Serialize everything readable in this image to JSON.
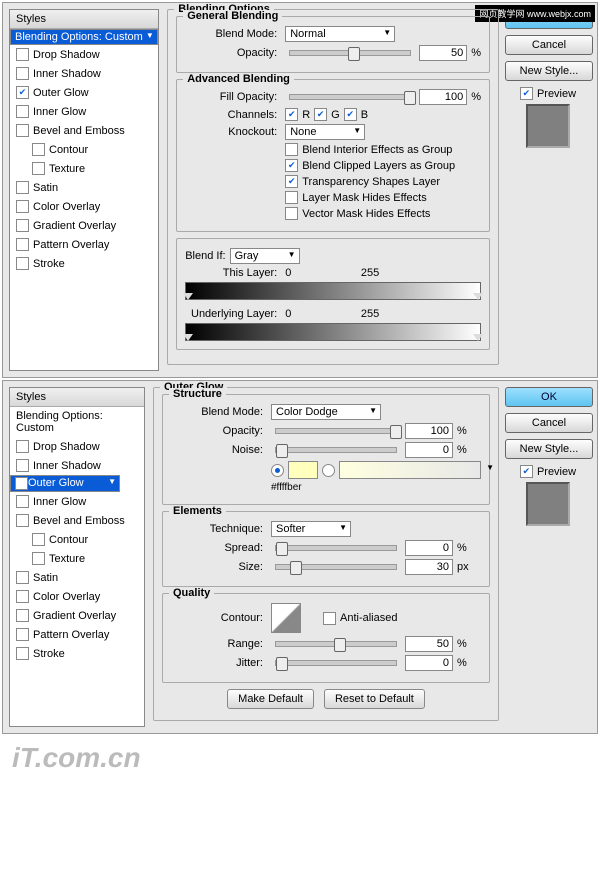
{
  "watermark": "网页教学网 www.webjx.com",
  "stylesHeader": "Styles",
  "styleItems": {
    "blendOpt": "Blending Options: Custom",
    "dropShadow": "Drop Shadow",
    "innerShadow": "Inner Shadow",
    "outerGlow": "Outer Glow",
    "innerGlow": "Inner Glow",
    "bevel": "Bevel and Emboss",
    "contour": "Contour",
    "texture": "Texture",
    "satin": "Satin",
    "colorOverlay": "Color Overlay",
    "gradOverlay": "Gradient Overlay",
    "patternOverlay": "Pattern Overlay",
    "stroke": "Stroke"
  },
  "buttons": {
    "ok": "OK",
    "cancel": "Cancel",
    "newStyle": "New Style...",
    "preview": "Preview",
    "makeDefault": "Make Default",
    "resetDefault": "Reset to Default"
  },
  "dialog1": {
    "title": "Blending Options",
    "general": {
      "title": "General Blending",
      "blendModeLabel": "Blend Mode:",
      "blendMode": "Normal",
      "opacityLabel": "Opacity:",
      "opacity": "50",
      "pct": "%"
    },
    "advanced": {
      "title": "Advanced Blending",
      "fillOpacityLabel": "Fill Opacity:",
      "fillOpacity": "100",
      "channelsLabel": "Channels:",
      "r": "R",
      "g": "G",
      "b": "B",
      "knockoutLabel": "Knockout:",
      "knockout": "None",
      "opt1": "Blend Interior Effects as Group",
      "opt2": "Blend Clipped Layers as Group",
      "opt3": "Transparency Shapes Layer",
      "opt4": "Layer Mask Hides Effects",
      "opt5": "Vector Mask Hides Effects"
    },
    "blendIf": {
      "label": "Blend If:",
      "mode": "Gray",
      "thisLayer": "This Layer:",
      "underLayer": "Underlying Layer:",
      "v0": "0",
      "v255": "255"
    }
  },
  "dialog2": {
    "title": "Outer Glow",
    "structure": {
      "title": "Structure",
      "blendModeLabel": "Blend Mode:",
      "blendMode": "Color Dodge",
      "opacityLabel": "Opacity:",
      "opacity": "100",
      "noiseLabel": "Noise:",
      "noise": "0",
      "pct": "%",
      "colorHex": "#ffffbe",
      "colorNote": "r"
    },
    "elements": {
      "title": "Elements",
      "techLabel": "Technique:",
      "tech": "Softer",
      "spreadLabel": "Spread:",
      "spread": "0",
      "sizeLabel": "Size:",
      "size": "30",
      "px": "px",
      "pct": "%"
    },
    "quality": {
      "title": "Quality",
      "contourLabel": "Contour:",
      "antiLabel": "Anti-aliased",
      "rangeLabel": "Range:",
      "range": "50",
      "jitterLabel": "Jitter:",
      "jitter": "0",
      "pct": "%"
    }
  },
  "logo": "iT.com.cn"
}
